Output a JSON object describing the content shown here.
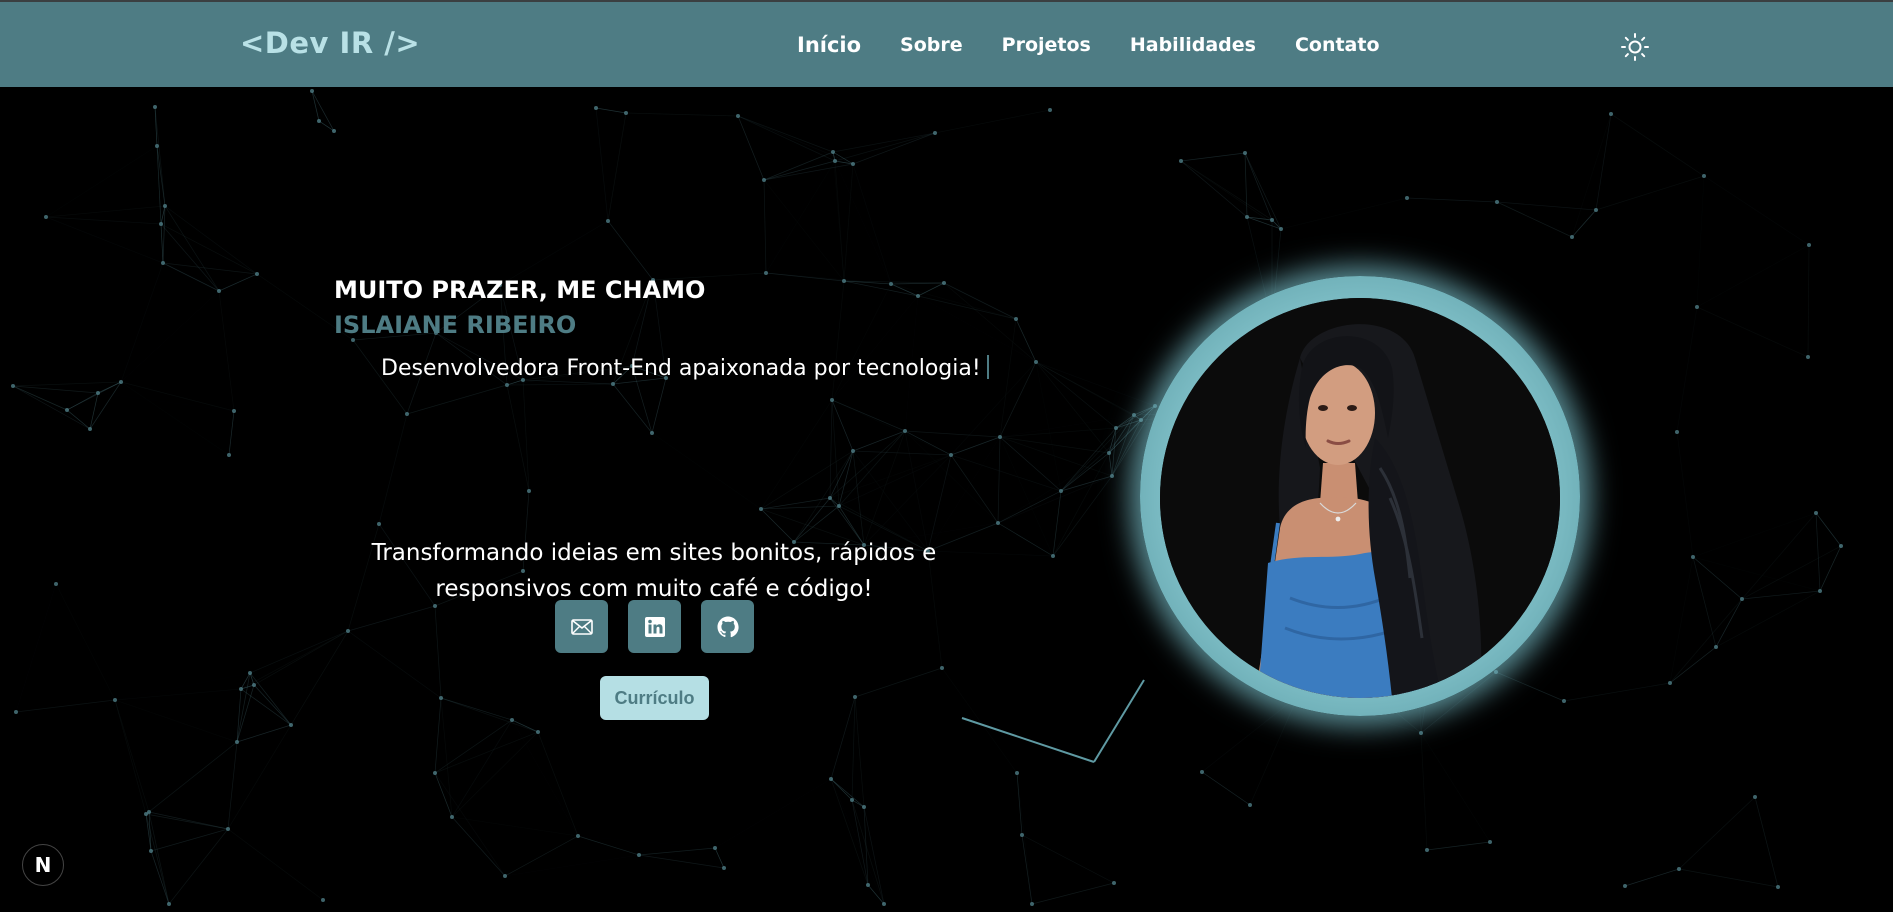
{
  "header": {
    "logo": "<Dev IR />",
    "nav": [
      {
        "label": "Início",
        "active": true
      },
      {
        "label": "Sobre"
      },
      {
        "label": "Projetos"
      },
      {
        "label": "Habilidades"
      },
      {
        "label": "Contato"
      }
    ],
    "theme_icon": "sun-icon"
  },
  "hero": {
    "greeting": "MUITO PRAZER, ME CHAMO",
    "name": "ISLAIANE RIBEIRO",
    "role": "Desenvolvedora Front-End apaixonada por tecnologia!",
    "tagline": "Transformando ideias em sites bonitos, rápidos e responsivos com muito café e código!",
    "social_icons": [
      "mail-icon",
      "linkedin-icon",
      "github-icon"
    ],
    "cv_label": "Currículo"
  },
  "badge": {
    "label": "N"
  },
  "colors": {
    "accent": "#4e7c84",
    "accent_light": "#b5dfe4",
    "background": "#000000",
    "text": "#ffffff"
  }
}
